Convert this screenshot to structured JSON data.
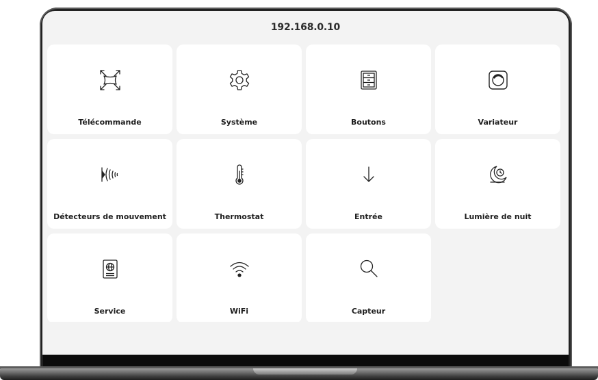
{
  "header": {
    "address": "192.168.0.10"
  },
  "tiles": [
    {
      "label": "Télécommande",
      "icon": "remote-control-icon"
    },
    {
      "label": "Système",
      "icon": "gear-icon"
    },
    {
      "label": "Boutons",
      "icon": "buttons-panel-icon"
    },
    {
      "label": "Variateur",
      "icon": "dimmer-icon"
    },
    {
      "label": "Détecteurs de mouvement",
      "icon": "motion-sensor-icon"
    },
    {
      "label": "Thermostat",
      "icon": "thermometer-icon"
    },
    {
      "label": "Entrée",
      "icon": "arrow-down-icon"
    },
    {
      "label": "Lumière de nuit",
      "icon": "night-light-icon"
    },
    {
      "label": "Service",
      "icon": "passport-icon"
    },
    {
      "label": "WiFi",
      "icon": "wifi-icon"
    },
    {
      "label": "Capteur",
      "icon": "magnifier-icon"
    }
  ],
  "colors": {
    "screen_bg": "#f3f3f3",
    "tile_bg": "#ffffff",
    "text": "#1e1e1e",
    "frame": "#222222"
  }
}
